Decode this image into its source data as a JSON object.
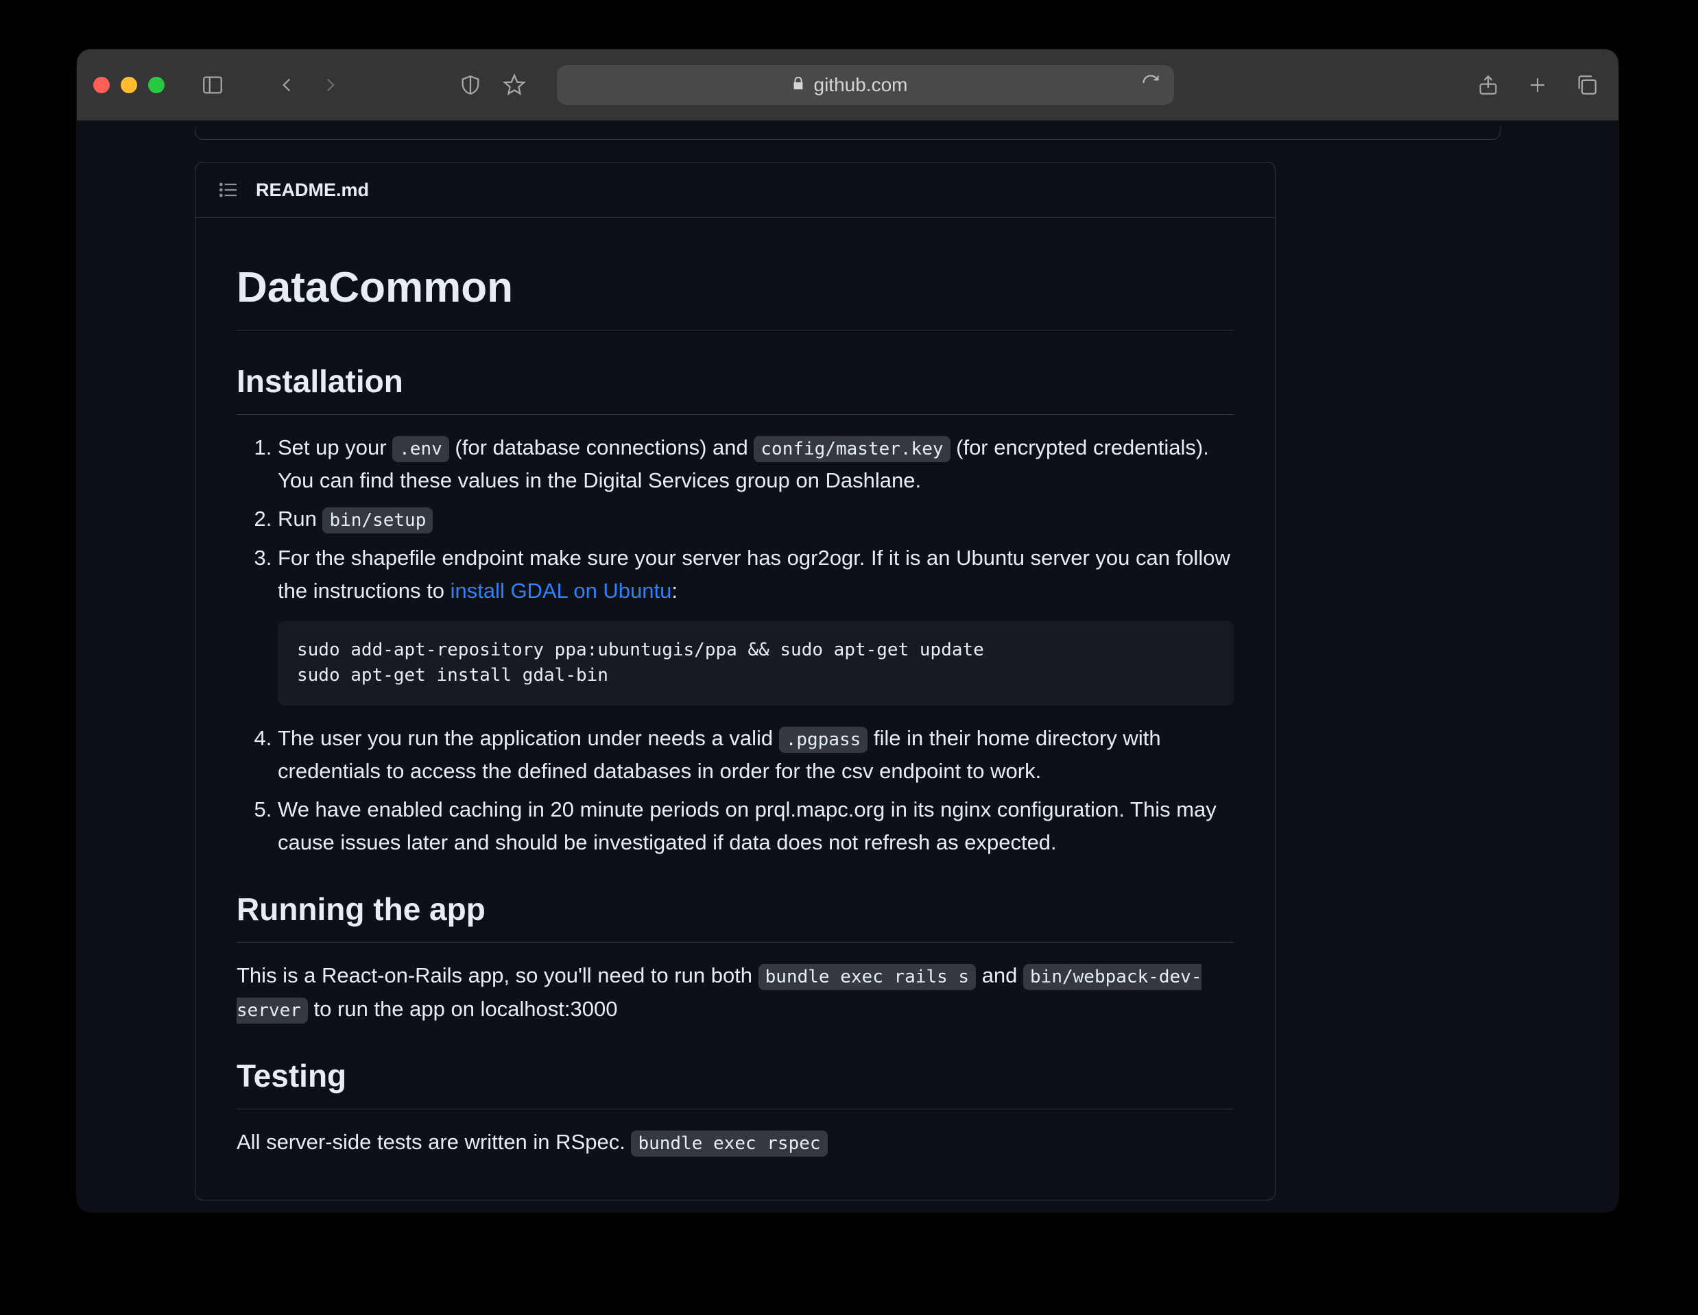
{
  "browser": {
    "url_host": "github.com"
  },
  "readme": {
    "filename": "README.md",
    "h1": "DataCommon",
    "h2_install": "Installation",
    "li1_a": "Set up your ",
    "li1_code1": ".env",
    "li1_b": " (for database connections) and ",
    "li1_code2": "config/master.key",
    "li1_c": " (for encrypted credentials). You can find these values in the Digital Services group on Dashlane.",
    "li2_a": "Run ",
    "li2_code": "bin/setup",
    "li3_a": "For the shapefile endpoint make sure your server has ogr2ogr. If it is an Ubuntu server you can follow the instructions to ",
    "li3_link": "install GDAL on Ubuntu",
    "li3_b": ":",
    "codeblock1": "sudo add-apt-repository ppa:ubuntugis/ppa && sudo apt-get update\nsudo apt-get install gdal-bin",
    "li4_a": "The user you run the application under needs a valid ",
    "li4_code": ".pgpass",
    "li4_b": " file in their home directory with credentials to access the defined databases in order for the csv endpoint to work.",
    "li5": "We have enabled caching in 20 minute periods on prql.mapc.org in its nginx configuration. This may cause issues later and should be investigated if data does not refresh as expected.",
    "h2_running": "Running the app",
    "running_a": "This is a React-on-Rails app, so you'll need to run both ",
    "running_code1": "bundle exec rails s",
    "running_b": " and ",
    "running_code2": "bin/webpack-dev-server",
    "running_c": " to run the app on localhost:3000",
    "h2_testing": "Testing",
    "testing_a": "All server-side tests are written in RSpec. ",
    "testing_code": "bundle exec rspec"
  }
}
